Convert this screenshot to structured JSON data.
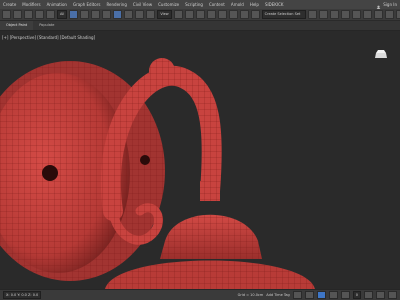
{
  "menubar": {
    "items": [
      "Create",
      "Modifiers",
      "Animation",
      "Graph Editors",
      "Rendering",
      "Civil View",
      "Customize",
      "Scripting",
      "Content",
      "Arnold",
      "Help",
      "SIDEKICK"
    ],
    "sign_in_label": "Sign In"
  },
  "toolbar": {
    "filter_dropdown": "All",
    "view_dropdown": "View",
    "selection_set_placeholder": "Create Selection Set"
  },
  "subbar": {
    "tabs": [
      "Object Paint",
      "Populate"
    ]
  },
  "viewport": {
    "label": "[+] [Perspective] [Standard] [Default Shading]",
    "icons": {
      "viewcube": "viewcube-icon"
    },
    "colors": {
      "mesh_red": "#c8433f",
      "background": "#2a2a2a",
      "wire": "#7a1a18"
    }
  },
  "statusbar": {
    "coords": "X: 0.0  Y: 0.0  Z: 0.0",
    "grid": "Grid = 10.0cm",
    "add_time_tag": "Add Time Tag",
    "frame": "0"
  }
}
